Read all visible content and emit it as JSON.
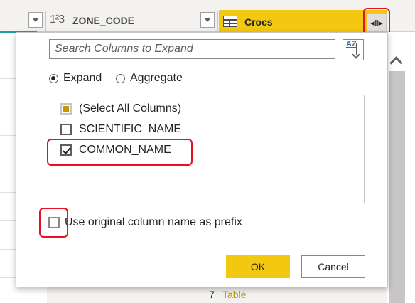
{
  "grid": {
    "columns": [
      {
        "type_label": "1²3",
        "title": "ZONE_CODE"
      },
      {
        "title": "Crocs"
      }
    ],
    "visible_row": {
      "number": "7",
      "value": "Table"
    }
  },
  "dialog": {
    "search_placeholder": "Search Columns to Expand",
    "sort_label": "AZ",
    "modes": [
      {
        "label": "Expand",
        "selected": true
      },
      {
        "label": "Aggregate",
        "selected": false
      }
    ],
    "columns": [
      {
        "label": "(Select All Columns)",
        "state": "indeterminate"
      },
      {
        "label": "SCIENTIFIC_NAME",
        "state": "unchecked"
      },
      {
        "label": "COMMON_NAME",
        "state": "checked"
      }
    ],
    "prefix": {
      "label": "Use original column name as prefix",
      "checked": false
    },
    "ok_label": "OK",
    "cancel_label": "Cancel"
  },
  "colors": {
    "accent": "#f2c811",
    "highlight": "#e81123",
    "teal": "#1aa0a8"
  },
  "icons": [
    "dropdown-icon",
    "number-type-icon",
    "table-icon",
    "expand-columns-icon",
    "sort-az-icon",
    "scroll-up-icon"
  ]
}
